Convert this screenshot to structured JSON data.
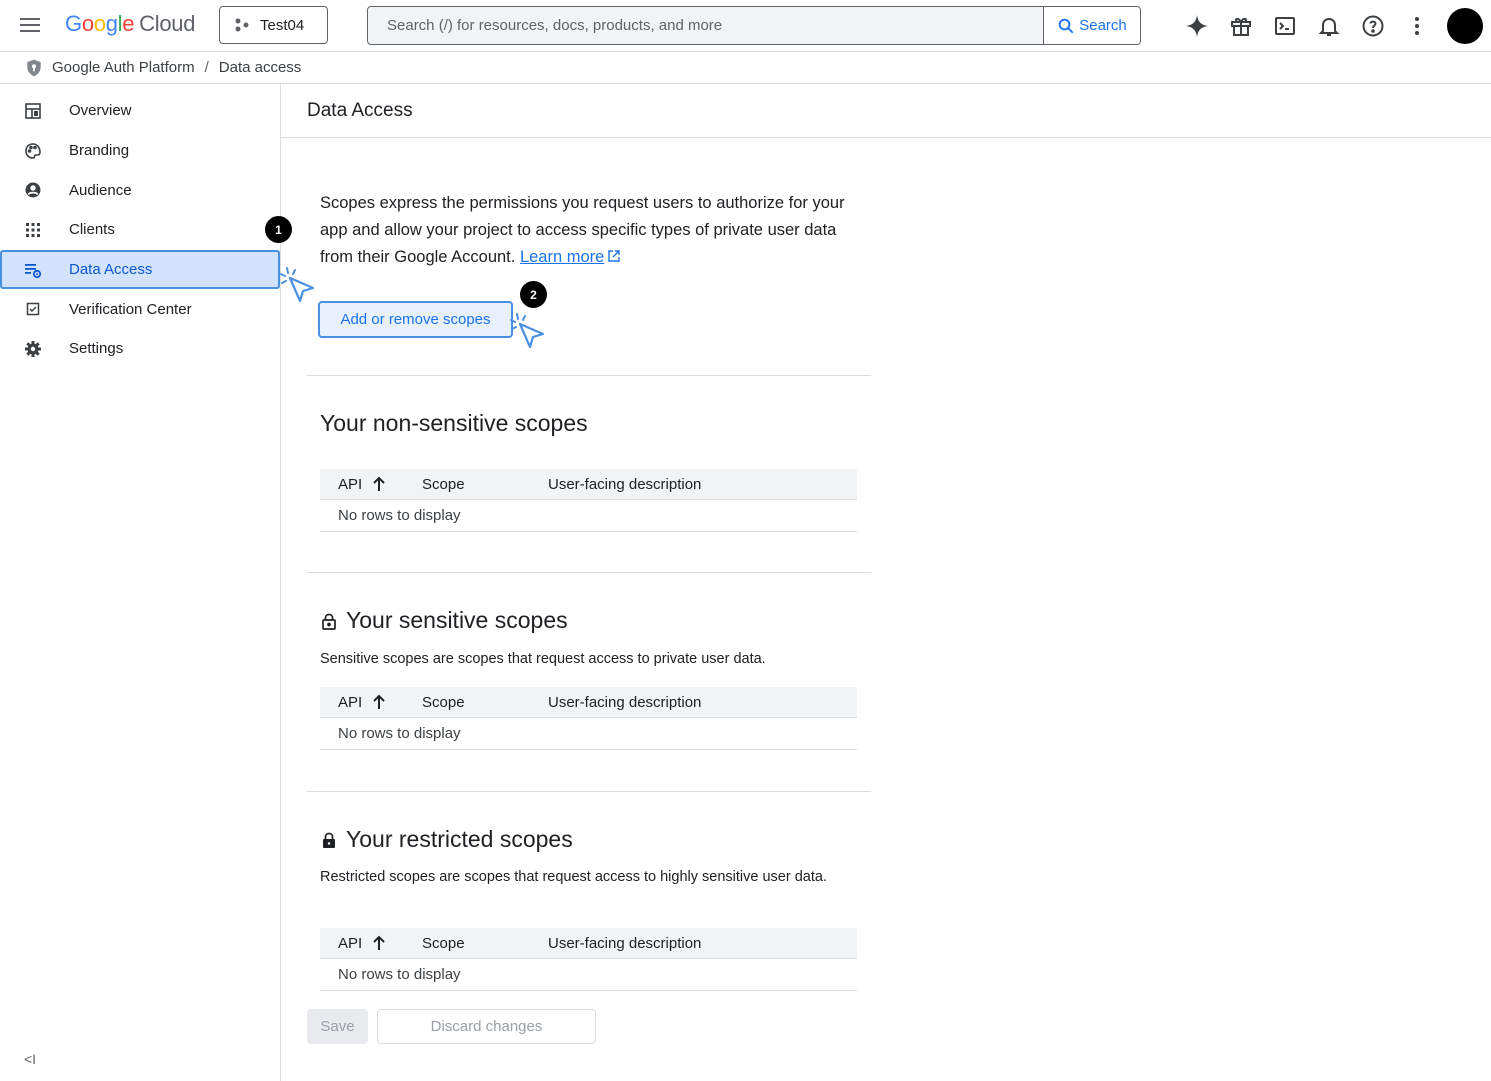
{
  "header": {
    "logo_google": "Google",
    "logo_cloud": "Cloud",
    "project": "Test04",
    "search_placeholder": "Search (/) for resources, docs, products, and more",
    "search_button": "Search"
  },
  "breadcrumb": {
    "root": "Google Auth Platform",
    "separator": "/",
    "current": "Data access"
  },
  "sidebar": {
    "items": [
      {
        "label": "Overview",
        "icon": "dashboard-icon"
      },
      {
        "label": "Branding",
        "icon": "palette-icon"
      },
      {
        "label": "Audience",
        "icon": "account-circle-icon"
      },
      {
        "label": "Clients",
        "icon": "apps-grid-icon"
      },
      {
        "label": "Data Access",
        "icon": "data-settings-icon",
        "active": true
      },
      {
        "label": "Verification Center",
        "icon": "checkbox-icon"
      },
      {
        "label": "Settings",
        "icon": "gear-icon"
      }
    ],
    "collapse_label": "<I"
  },
  "main": {
    "title": "Data Access",
    "intro": "Scopes express the permissions you request users to authorize for your app and allow your project to access specific types of private user data from their Google Account.",
    "learn_more": "Learn more",
    "add_button": "Add or remove scopes",
    "table_headers": {
      "api": "API",
      "scope": "Scope",
      "description": "User-facing description"
    },
    "empty_text": "No rows to display",
    "non_sensitive": {
      "title": "Your non-sensitive scopes"
    },
    "sensitive": {
      "title": "Your sensitive scopes",
      "description": "Sensitive scopes are scopes that request access to private user data."
    },
    "restricted": {
      "title": "Your restricted scopes",
      "description": "Restricted scopes are scopes that request access to highly sensitive user data."
    },
    "save_button": "Save",
    "discard_button": "Discard changes"
  },
  "annotations": {
    "badge_1": "1",
    "badge_2": "2"
  },
  "colors": {
    "accent": "#1a73e8",
    "active_bg": "#d3e3fd",
    "annotation_border": "#4a90e2"
  }
}
